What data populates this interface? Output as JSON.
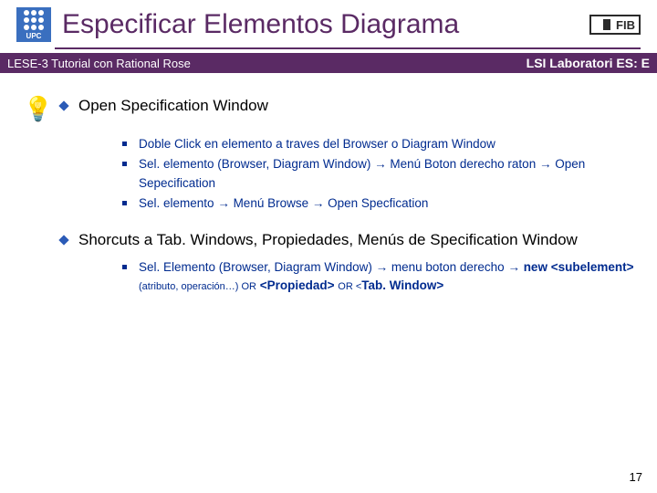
{
  "header": {
    "upc_label": "UPC",
    "title": "Especificar Elementos Diagrama",
    "fib_label": "FIB"
  },
  "subbar": {
    "left": "LESE-3 Tutorial con Rational Rose",
    "right": "LSI Laboratori ES: E"
  },
  "section1": {
    "heading": "Open Specification Window",
    "items": {
      "a": "Doble Click en elemento a traves del  Browser o Diagram Window",
      "b_pre": "Sel. elemento (Browser, Diagram Window) ",
      "b_mid": " Menú Boton derecho raton ",
      "b_post": " Open Sepecification",
      "c_pre": "Sel. elemento ",
      "c_mid": " Menú Browse ",
      "c_post": " Open Specfication"
    }
  },
  "section2": {
    "heading": "Shorcuts a Tab. Windows, Propiedades, Menús de Specification Window",
    "item": {
      "pre": "Sel. Elemento (Browser, Diagram Window) ",
      "m1": " menu boton derecho ",
      "m2": " new <subelement> ",
      "attr": "(atributo, operación…) OR",
      "m3": " <Propiedad> ",
      "or2": "OR ",
      "m4": "<",
      "m4b": "Tab. Window>"
    }
  },
  "arrow_glyph": "→",
  "page_number": "17"
}
